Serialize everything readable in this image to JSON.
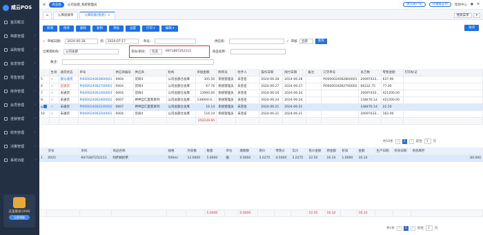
{
  "sidebar": {
    "app_name": "威云POS",
    "items": [
      {
        "label": "首页概况"
      },
      {
        "label": "档案管理"
      },
      {
        "label": "采购管理"
      },
      {
        "label": "批发管理"
      },
      {
        "label": "零售管理"
      },
      {
        "label": "库存管理"
      },
      {
        "label": "会员管理"
      },
      {
        "label": "连锁管理"
      },
      {
        "label": "财务管理"
      },
      {
        "label": "决策管理"
      },
      {
        "label": "系统功能"
      }
    ],
    "promo_title": "这里最省100W",
    "promo_button": "立即领取"
  },
  "header": {
    "shop_badge": "商业版",
    "path": "公司总部_系统管理员",
    "btn_service": "进入商户论",
    "btn_upgrade": "开通威支付",
    "help": "帮助中心"
  },
  "tabs": {
    "items": [
      {
        "label": "入库验收单"
      },
      {
        "label": "入库验收(批退)"
      }
    ],
    "right_search": "搜索菜单"
  },
  "toolbar": {
    "buttons": [
      "新增",
      "修改",
      "删除",
      "复制",
      "审核",
      "设置",
      "打印",
      "编辑"
    ],
    "close": "关闭"
  },
  "filter": {
    "audit_date_label": "审核日期：",
    "date_from": "2024-06-18",
    "to_label": "到",
    "date_to": "2024-07-17",
    "order_label": "单号：",
    "supplier_label": "供应商：",
    "audit_label": "审核",
    "audit_value": "全部",
    "query": "查询",
    "warehouse_label": "仓库或机构：",
    "warehouse_value": "公司总部",
    "barcode_label": "货号/条码：",
    "barcode_mode": "包含",
    "barcode_value": "6971807252111",
    "product_label": "商品名称：",
    "remark_label": "备注："
  },
  "grid1": {
    "headers": [
      "",
      "生效",
      "通货状态",
      "单号",
      "供应商编号",
      "供应商",
      "机构",
      "单据金额",
      "制单员",
      "经手人",
      "操作日期",
      "限付日期",
      "备注",
      "订货单号",
      "总万数",
      "零售金额",
      "打印标记"
    ],
    "rows": [
      {
        "n": "5",
        "status": "部分通货",
        "no": "PI000024062800001",
        "code": "0004",
        "supplier": "货商4",
        "org": "公司总部仓总库",
        "amount": "305.50",
        "maker": "系统管理员",
        "handler": "未签名",
        "op": "2024-06-28",
        "due": "2024-06-28",
        "remark": "",
        "po": "PO000024062800001",
        "qty": "20097433...",
        "retail": "637.90"
      },
      {
        "n": "6",
        "status": "已退货",
        "no": "PI000024062700001",
        "code": "0004",
        "supplier": "货商4",
        "org": "公司总部仓总库",
        "amount": "67.76",
        "maker": "系统管理员",
        "handler": "未签名",
        "op": "2024-06-27",
        "due": "2024-06-27",
        "remark": "",
        "po": "PO000024062700002",
        "qty": "66232.75",
        "retail": "77.00"
      },
      {
        "n": "7",
        "status": "未通货",
        "no": "PI000024062400003",
        "code": "0004",
        "supplier": "货商4",
        "org": "公司总部仓总库",
        "amount": "13900.00",
        "maker": "系统管理员",
        "handler": "未签名",
        "op": "2024-06-24",
        "due": "2024-06-24",
        "remark": "",
        "po": "",
        "qty": "20097433...",
        "retail": "421200.00"
      },
      {
        "n": "8",
        "status": "未通货",
        "no": "PI000024062400002",
        "code": "0007",
        "supplier": "神神自仁医客系列",
        "org": "公司总部仓总库",
        "amount": "138900.0...",
        "maker": "系统管理员",
        "handler": "未签名",
        "op": "2024-06-24",
        "due": "2024-06-24",
        "remark": "",
        "po": "",
        "qty": "138476.14",
        "retail": "421200.00"
      },
      {
        "n": "9",
        "status": "未通货",
        "no": "PI000024062100002",
        "code": "0007",
        "supplier": "神神自仁医客系列",
        "org": "公司总部仓总库",
        "amount": "16.14",
        "maker": "系统管理员",
        "handler": "未签名",
        "op": "2024-06-21",
        "due": "2024-06-21",
        "remark": "",
        "po": "",
        "qty": "138476.14",
        "retail": "22.50"
      },
      {
        "n": "10",
        "status": "未通货",
        "no": "PI000024062100001",
        "code": "0004",
        "supplier": "货商4",
        "org": "公司总部仓总库",
        "amount": "116.19",
        "maker": "系统管理员",
        "handler": "未签名",
        "op": "2024-06-21",
        "due": "2024-06-21",
        "remark": "",
        "po": "",
        "qty": "20097433...",
        "retail": "162.00"
      }
    ],
    "total_amount": "292239.85",
    "pager_text": "共10条",
    "page": "1",
    "goto": "前往",
    "page2": "1",
    "page_unit": "页"
  },
  "grid2": {
    "headers": [
      "",
      "货号",
      "条码",
      "商品名称",
      "规格",
      "内装数",
      "数量",
      "单位",
      "赠数数",
      "原价",
      "零售价",
      "实价",
      "售价金额",
      "原金额",
      "折扣",
      "金额",
      "生产日期",
      "有效日期",
      "系统库存"
    ],
    "rows": [
      {
        "n": "1",
        "code": "0025",
        "barcode": "6971807252111",
        "name": "阿萨姆奶茶",
        "spec": "500ml",
        "pack": "12.0000",
        "qty": "5.0000",
        "unit": "瓶",
        "gift": "0.0000",
        "orig": "3.2275",
        "retail": "4.5000",
        "real": "3.2275",
        "sale_amt": "22.50",
        "orig_amt": "16.14",
        "disc": "1.0000",
        "amt": "16.14",
        "mfg": "",
        "exp": "",
        "stock": "84.000"
      }
    ],
    "totals": {
      "qty": "5.0000",
      "gift": "0.0000",
      "sale_amt": "22.50",
      "orig_amt": "16.14",
      "amt": "16.14"
    },
    "pager_text": "共1条",
    "page": "1",
    "goto": "前往",
    "page2": "1",
    "page_unit": "页"
  }
}
